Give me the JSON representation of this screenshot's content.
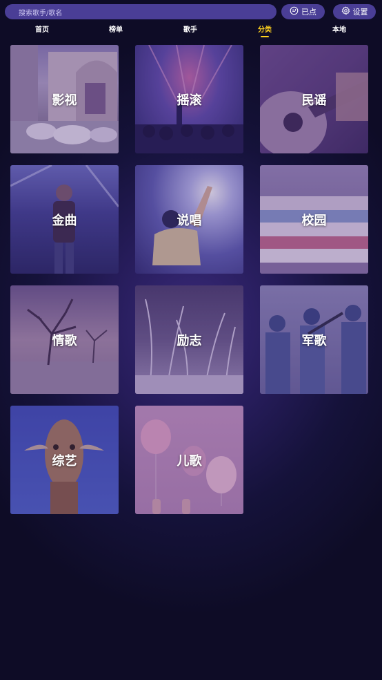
{
  "search": {
    "placeholder": "搜索歌手/歌名"
  },
  "header": {
    "queue_label": "已点",
    "settings_label": "设置"
  },
  "nav": {
    "items": [
      "首页",
      "榜单",
      "歌手",
      "分类",
      "本地"
    ],
    "active": "分类"
  },
  "categories": [
    {
      "label": "影视",
      "image": "village-with-sheep"
    },
    {
      "label": "摇滚",
      "image": "rock-concert-stage"
    },
    {
      "label": "民谣",
      "image": "acoustic-guitar"
    },
    {
      "label": "金曲",
      "image": "female-singer-on-stage"
    },
    {
      "label": "说唱",
      "image": "rapper-raising-hand"
    },
    {
      "label": "校园",
      "image": "stack-of-books"
    },
    {
      "label": "情歌",
      "image": "bare-tree-field"
    },
    {
      "label": "励志",
      "image": "reeds-in-wind"
    },
    {
      "label": "军歌",
      "image": "soldiers-in-camouflage"
    },
    {
      "label": "综艺",
      "image": "giraffe-head"
    },
    {
      "label": "儿歌",
      "image": "pink-balloons"
    }
  ],
  "colors": {
    "accent": "#ffd21e",
    "pill": "#4a3e96",
    "background": "#0e0c26"
  }
}
